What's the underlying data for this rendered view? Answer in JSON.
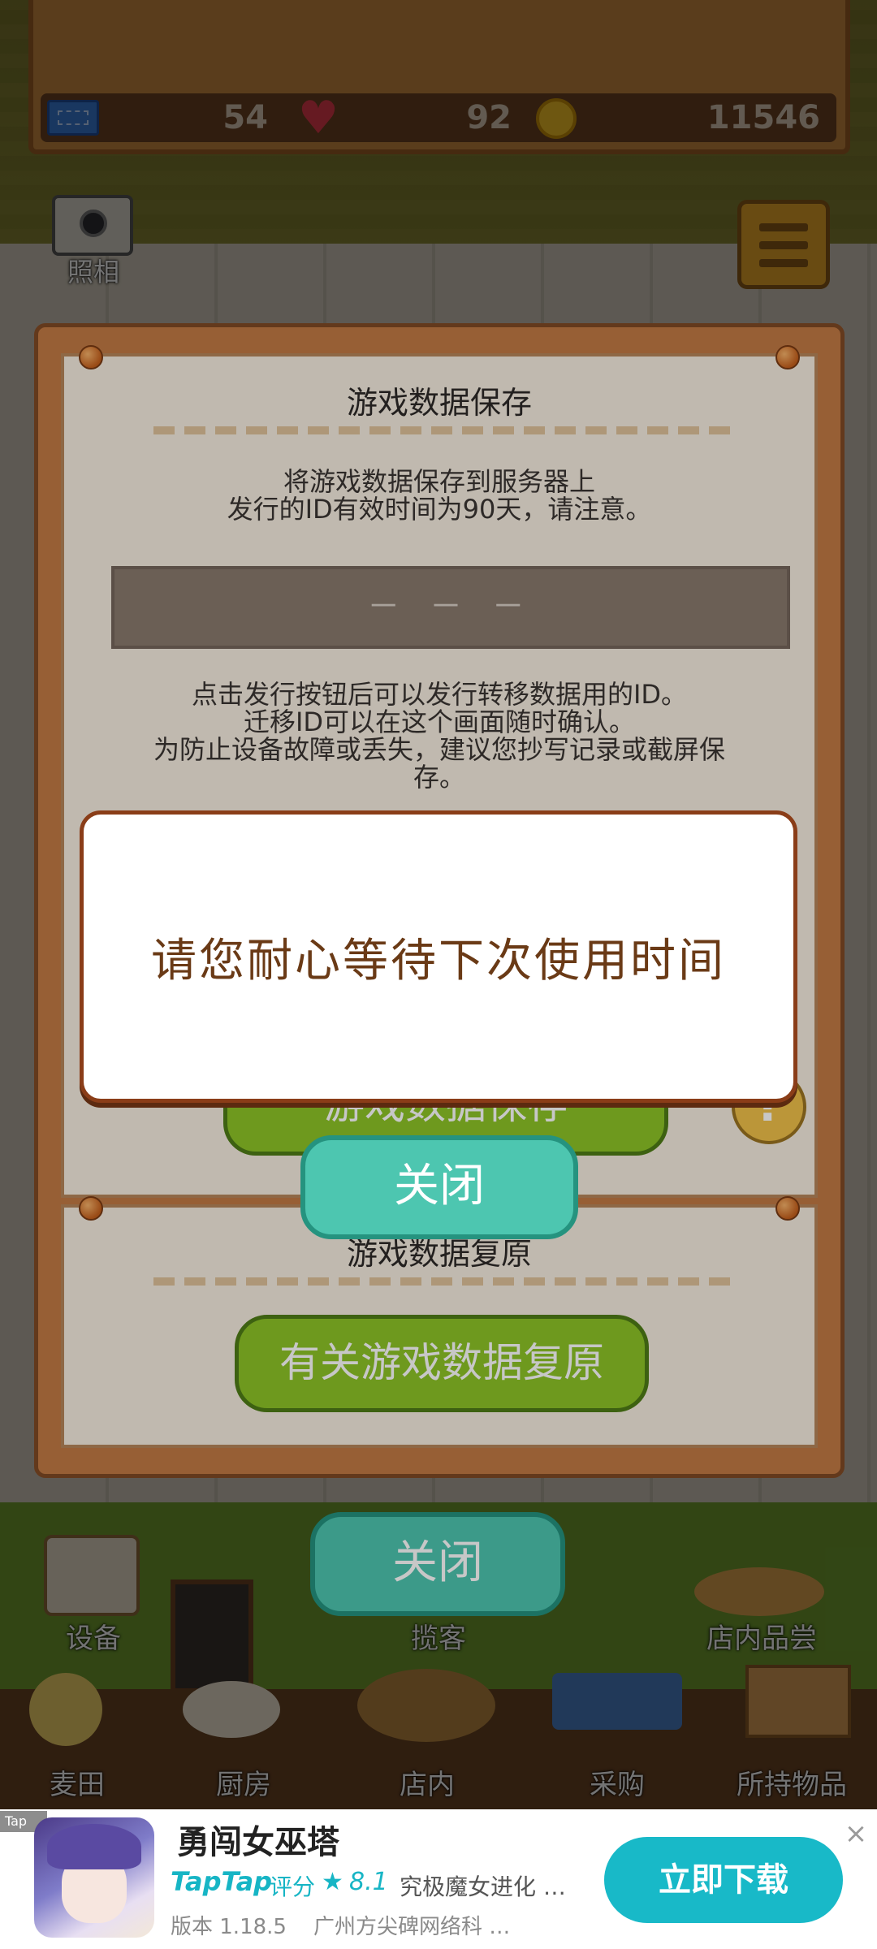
{
  "hud": {
    "tickets": "54",
    "hearts": "92",
    "coins": "11546",
    "camera_label": "照相"
  },
  "bottom_nav": {
    "equipment": "设备",
    "solicit": "揽客",
    "tasting": "店内品尝",
    "wheat_field": "麦田",
    "kitchen": "厨房",
    "in_store": "店内",
    "purchase": "采购",
    "inventory": "所持物品",
    "close": "关闭"
  },
  "save_card": {
    "title": "游戏数据保存",
    "line1": "将游戏数据保存到服务器上",
    "line2": "发行的ID有效时间为90天，请注意。",
    "id_placeholder": "－ － －",
    "info1": "点击发行按钮后可以发行转移数据用的ID。",
    "info2": "迁移ID可以在这个画面随时确认。",
    "info3": "为防止设备故障或丢失，建议您抄写记录或截屏保",
    "info4": "存。",
    "save_button": "游戏数据保存",
    "help": "?"
  },
  "restore_card": {
    "title": "游戏数据复原",
    "restore_button": "有关游戏数据复原"
  },
  "popup": {
    "message": "请您耐心等待下次使用时间",
    "close_button": "关闭"
  },
  "ad": {
    "tag": "Tap",
    "title": "勇闯女巫塔",
    "taptap": "TapTap",
    "rating_label": "评分",
    "rating": "8.1",
    "tagline": "究极魔女进化 …",
    "version": "版本 1.18.5",
    "company": "广州方尖碑网络科 …",
    "download": "立即下载",
    "close": "×"
  },
  "colors": {
    "panel_wood": "#c27a44",
    "card": "#f7eee0",
    "teal_button": "#4dc6b0",
    "green_button": "#8dc427",
    "popup_text": "#6a3a16",
    "ad_accent": "#18b9c8"
  }
}
